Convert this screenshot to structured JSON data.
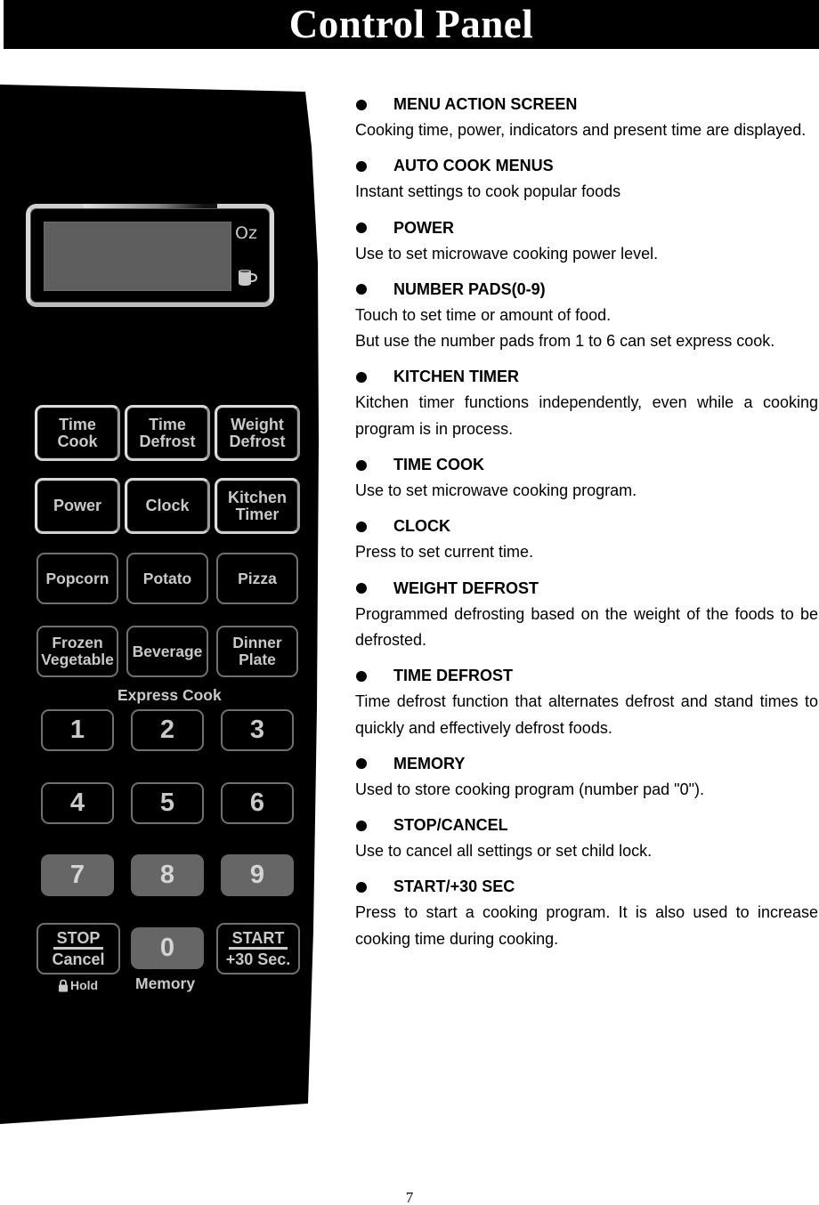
{
  "header": {
    "title": "Control Panel"
  },
  "panel": {
    "display": {
      "unit_label": "Oz",
      "indicator_icon": "cup-icon"
    },
    "function_keys": [
      {
        "lines": [
          "Time",
          "Cook"
        ]
      },
      {
        "lines": [
          "Time",
          "Defrost"
        ]
      },
      {
        "lines": [
          "Weight",
          "Defrost"
        ]
      },
      {
        "lines": [
          "Power"
        ]
      },
      {
        "lines": [
          "Clock"
        ]
      },
      {
        "lines": [
          "Kitchen",
          "Timer"
        ]
      }
    ],
    "auto_menu_keys": [
      {
        "lines": [
          "Popcorn"
        ]
      },
      {
        "lines": [
          "Potato"
        ]
      },
      {
        "lines": [
          "Pizza"
        ]
      },
      {
        "lines": [
          "Frozen",
          "Vegetable"
        ]
      },
      {
        "lines": [
          "Beverage"
        ]
      },
      {
        "lines": [
          "Dinner",
          "Plate"
        ]
      }
    ],
    "express_cook_label": "Express Cook",
    "number_keys": [
      "1",
      "2",
      "3",
      "4",
      "5",
      "6",
      "7",
      "8",
      "9",
      "0"
    ],
    "stop_key": {
      "top": "STOP",
      "bottom": "Cancel"
    },
    "start_key": {
      "top": "START",
      "bottom": "+30 Sec."
    },
    "hold_label": "Hold",
    "memory_label": "Memory",
    "colors": {
      "panel": "#000000",
      "key_text": "#c9c9c9",
      "filled_key": "#666666",
      "lcd": "#5e5e5e"
    }
  },
  "descriptions": [
    {
      "heading": "MENU ACTION SCREEN",
      "lines": [
        "Cooking time, power, indicators and present time are displayed."
      ]
    },
    {
      "heading": "AUTO COOK MENUS",
      "lines": [
        "Instant settings to cook popular foods"
      ]
    },
    {
      "heading": "POWER",
      "lines": [
        "Use to set microwave cooking power level."
      ]
    },
    {
      "heading": "NUMBER PADS(0-9)",
      "lines": [
        "Touch to set time or amount of food.",
        "But use the number pads from 1 to 6 can set express cook."
      ]
    },
    {
      "heading": "KITCHEN TIMER",
      "lines": [
        "Kitchen timer functions independently, even while a cooking program is in process."
      ]
    },
    {
      "heading": "TIME COOK",
      "lines": [
        "Use to set microwave cooking program."
      ]
    },
    {
      "heading": "CLOCK",
      "lines": [
        "Press to set current time."
      ]
    },
    {
      "heading": "WEIGHT DEFROST",
      "lines": [
        "Programmed defrosting based on the weight of the foods to be defrosted."
      ]
    },
    {
      "heading": "TIME DEFROST",
      "lines": [
        "Time defrost function that alternates defrost and stand times to quickly and effectively defrost foods."
      ]
    },
    {
      "heading": "MEMORY",
      "lines": [
        "Used to store cooking program (number pad \"0\")."
      ]
    },
    {
      "heading": "STOP/CANCEL",
      "lines": [
        "Use to cancel all settings or set child lock."
      ]
    },
    {
      "heading": "START/+30 SEC",
      "lines": [
        "Press to start a cooking program. It is also used to increase cooking time during cooking."
      ]
    }
  ],
  "footer": {
    "page_number": "7"
  }
}
